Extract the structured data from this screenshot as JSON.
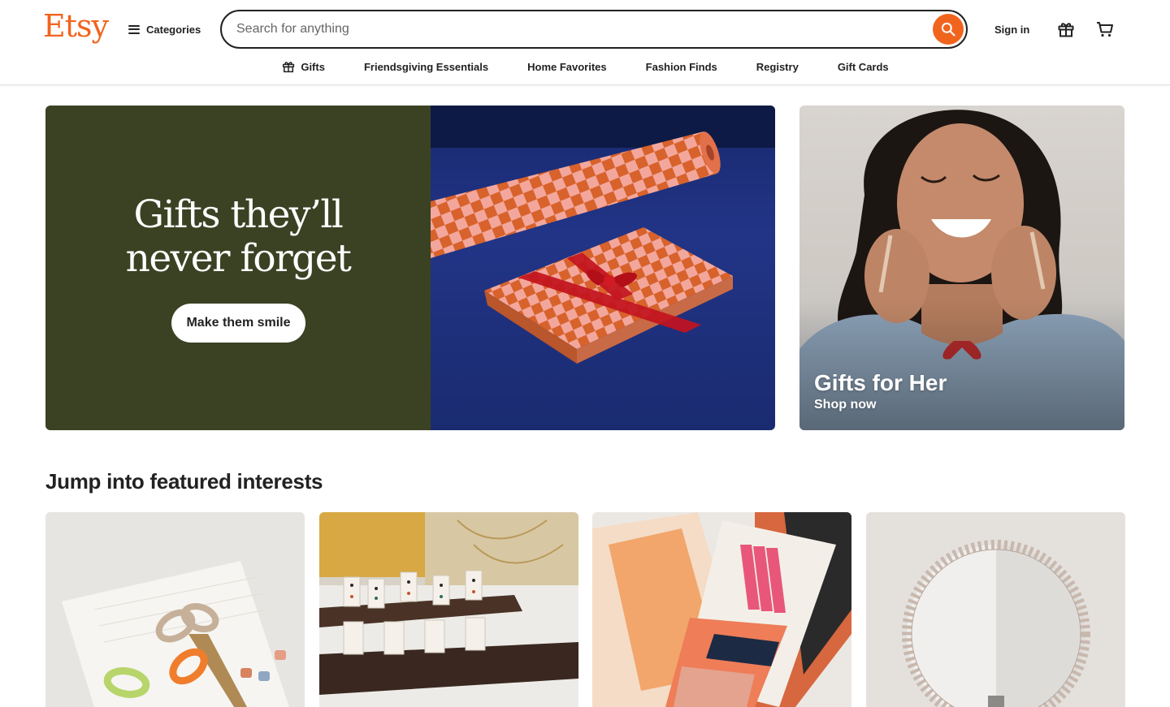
{
  "header": {
    "logo": "Etsy",
    "categories_label": "Categories",
    "search_placeholder": "Search for anything",
    "search_value": "",
    "signin_label": "Sign in",
    "accent_color": "#f1641e"
  },
  "subnav": {
    "items": [
      {
        "label": "Gifts",
        "icon": "gift-icon"
      },
      {
        "label": "Friendsgiving Essentials"
      },
      {
        "label": "Home Favorites"
      },
      {
        "label": "Fashion Finds"
      },
      {
        "label": "Registry"
      },
      {
        "label": "Gift Cards"
      }
    ]
  },
  "hero": {
    "title_line1": "Gifts they’ll",
    "title_line2": "never forget",
    "cta": "Make them smile",
    "bg_color": "#3a4223"
  },
  "promo": {
    "title": "Gifts for Her",
    "link": "Shop now"
  },
  "featured": {
    "heading": "Jump into featured interests",
    "cards": [
      {
        "image": "scissors-crafting-supplies"
      },
      {
        "image": "dominoes-game-set"
      },
      {
        "image": "pencils-stationery"
      },
      {
        "image": "beaded-round-mirror"
      }
    ]
  }
}
